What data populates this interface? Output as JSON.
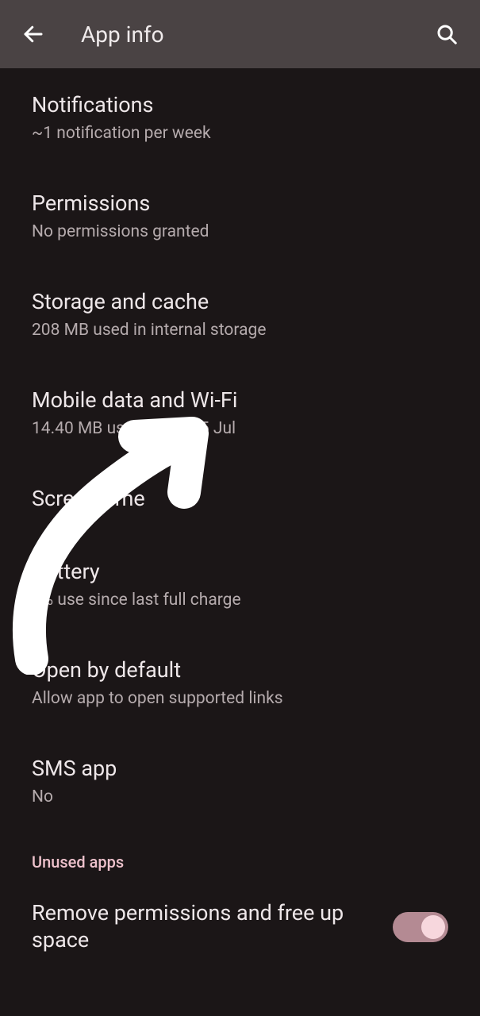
{
  "header": {
    "title": "App info"
  },
  "items": {
    "notifications": {
      "title": "Notifications",
      "sub": "~1 notification per week"
    },
    "permissions": {
      "title": "Permissions",
      "sub": "No permissions granted"
    },
    "storage": {
      "title": "Storage and cache",
      "sub": "208 MB used in internal storage"
    },
    "data": {
      "title": "Mobile data and Wi-Fi",
      "sub": "14.40 MB used since 25 Jul"
    },
    "screentime": {
      "title": "Screen time"
    },
    "battery": {
      "title": "Battery",
      "sub": "0% use since last full charge"
    },
    "openbydefault": {
      "title": "Open by default",
      "sub": "Allow app to open supported links"
    },
    "sms": {
      "title": "SMS app",
      "sub": "No"
    }
  },
  "section": {
    "unused": "Unused apps"
  },
  "toggle": {
    "remove_perm": "Remove permissions and free up space"
  }
}
